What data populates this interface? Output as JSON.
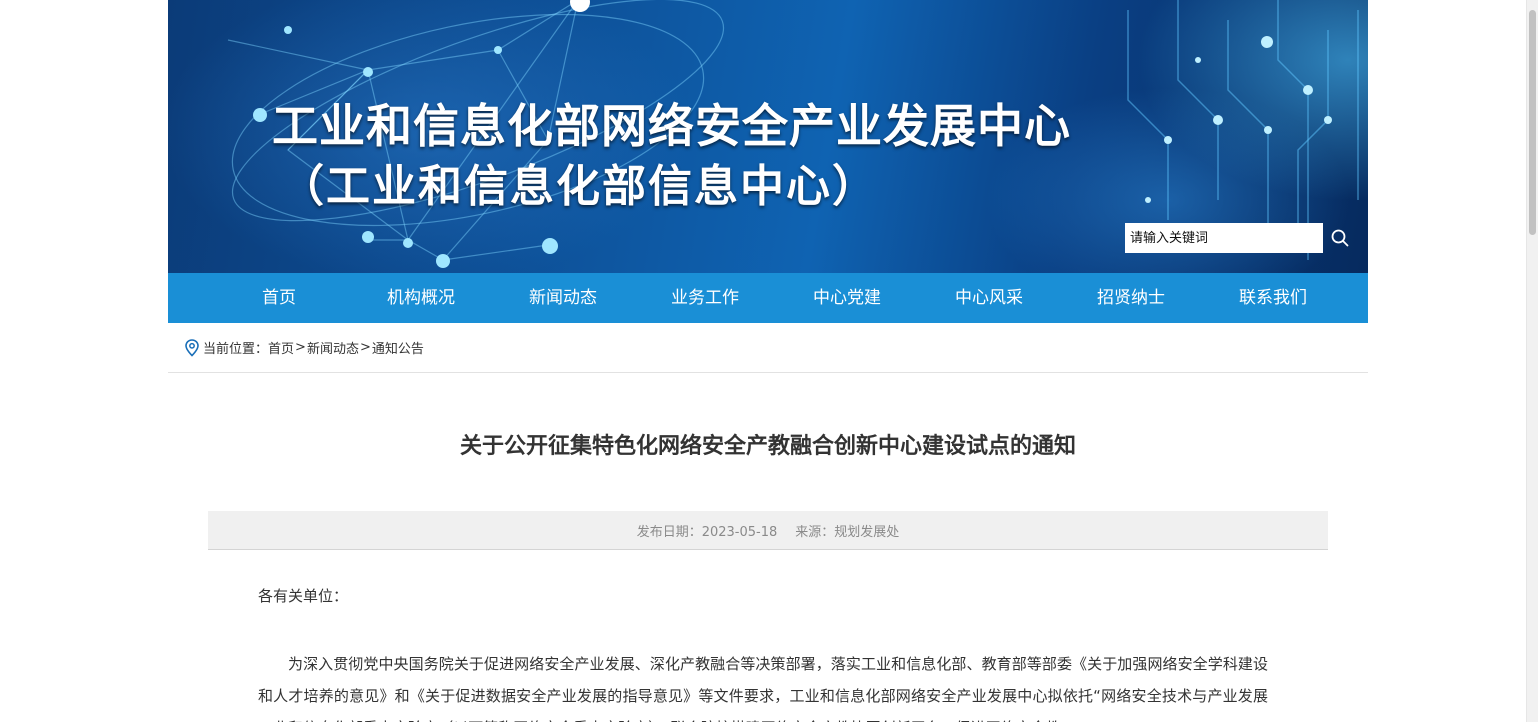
{
  "header": {
    "title": "工业和信息化部网络安全产业发展中心",
    "subtitle": "（工业和信息化部信息中心）"
  },
  "search": {
    "placeholder": "请输入关键词"
  },
  "nav": {
    "items": [
      {
        "label": "首页"
      },
      {
        "label": "机构概况"
      },
      {
        "label": "新闻动态"
      },
      {
        "label": "业务工作"
      },
      {
        "label": "中心党建"
      },
      {
        "label": "中心风采"
      },
      {
        "label": "招贤纳士"
      },
      {
        "label": "联系我们"
      }
    ]
  },
  "breadcrumb": {
    "prefix": "当前位置：",
    "items": [
      "首页",
      "新闻动态",
      "通知公告"
    ],
    "separator": ">"
  },
  "article": {
    "title": "关于公开征集特色化网络安全产教融合创新中心建设试点的通知",
    "date_label": "发布日期：2023-05-18",
    "source_label": "来源：规划发展处",
    "salutation": "各有关单位：",
    "paragraph1": "为深入贯彻党中央国务院关于促进网络安全产业发展、深化产教融合等决策部署，落实工业和信息化部、教育部等部委《关于加强网络安全学科建设和人才培养的意见》和《关于促进数据安全产业发展的指导意见》等文件要求，工业和信息化部网络安全产业发展中心拟依托“网络安全技术与产业发展工业和信息化部重点实验室”（以下简称网络安全重点实验室），联合院校搭建网络安全产教协同创新平台，促进网络安全教"
  },
  "colors": {
    "nav_bg": "#1a8fd6",
    "meta_bg": "#f0f0f0",
    "banner_dark": "#0b3b78"
  }
}
